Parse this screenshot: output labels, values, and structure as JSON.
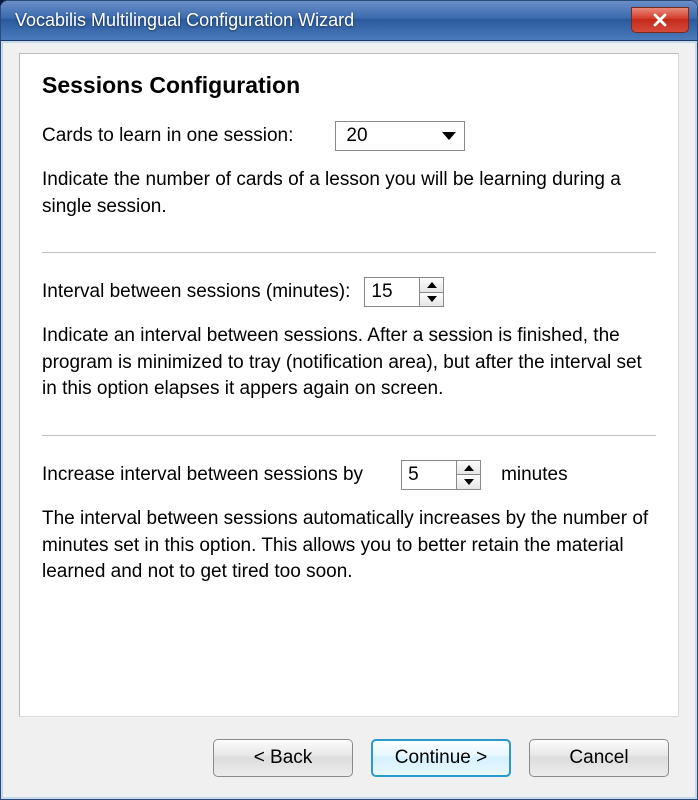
{
  "window": {
    "title": "Vocabilis Multilingual Configuration Wizard"
  },
  "heading": "Sessions Configuration",
  "section_cards": {
    "label": "Cards to learn in one session:",
    "value": "20",
    "desc": "Indicate the number of cards of a lesson you will be learning during a single session."
  },
  "section_interval": {
    "label": "Interval between sessions (minutes):",
    "value": "15",
    "desc": "Indicate an interval between sessions. After a session is finished, the program is minimized to tray (notification area), but after the interval set in this option elapses it appers again on screen."
  },
  "section_increase": {
    "label": "Increase interval between sessions by",
    "value": "5",
    "suffix": "minutes",
    "desc": "The interval between sessions automatically increases by the number of minutes set in this option. This allows you to better retain the material learned and not to get tired too soon."
  },
  "buttons": {
    "back": "< Back",
    "continue": "Continue >",
    "cancel": "Cancel"
  }
}
